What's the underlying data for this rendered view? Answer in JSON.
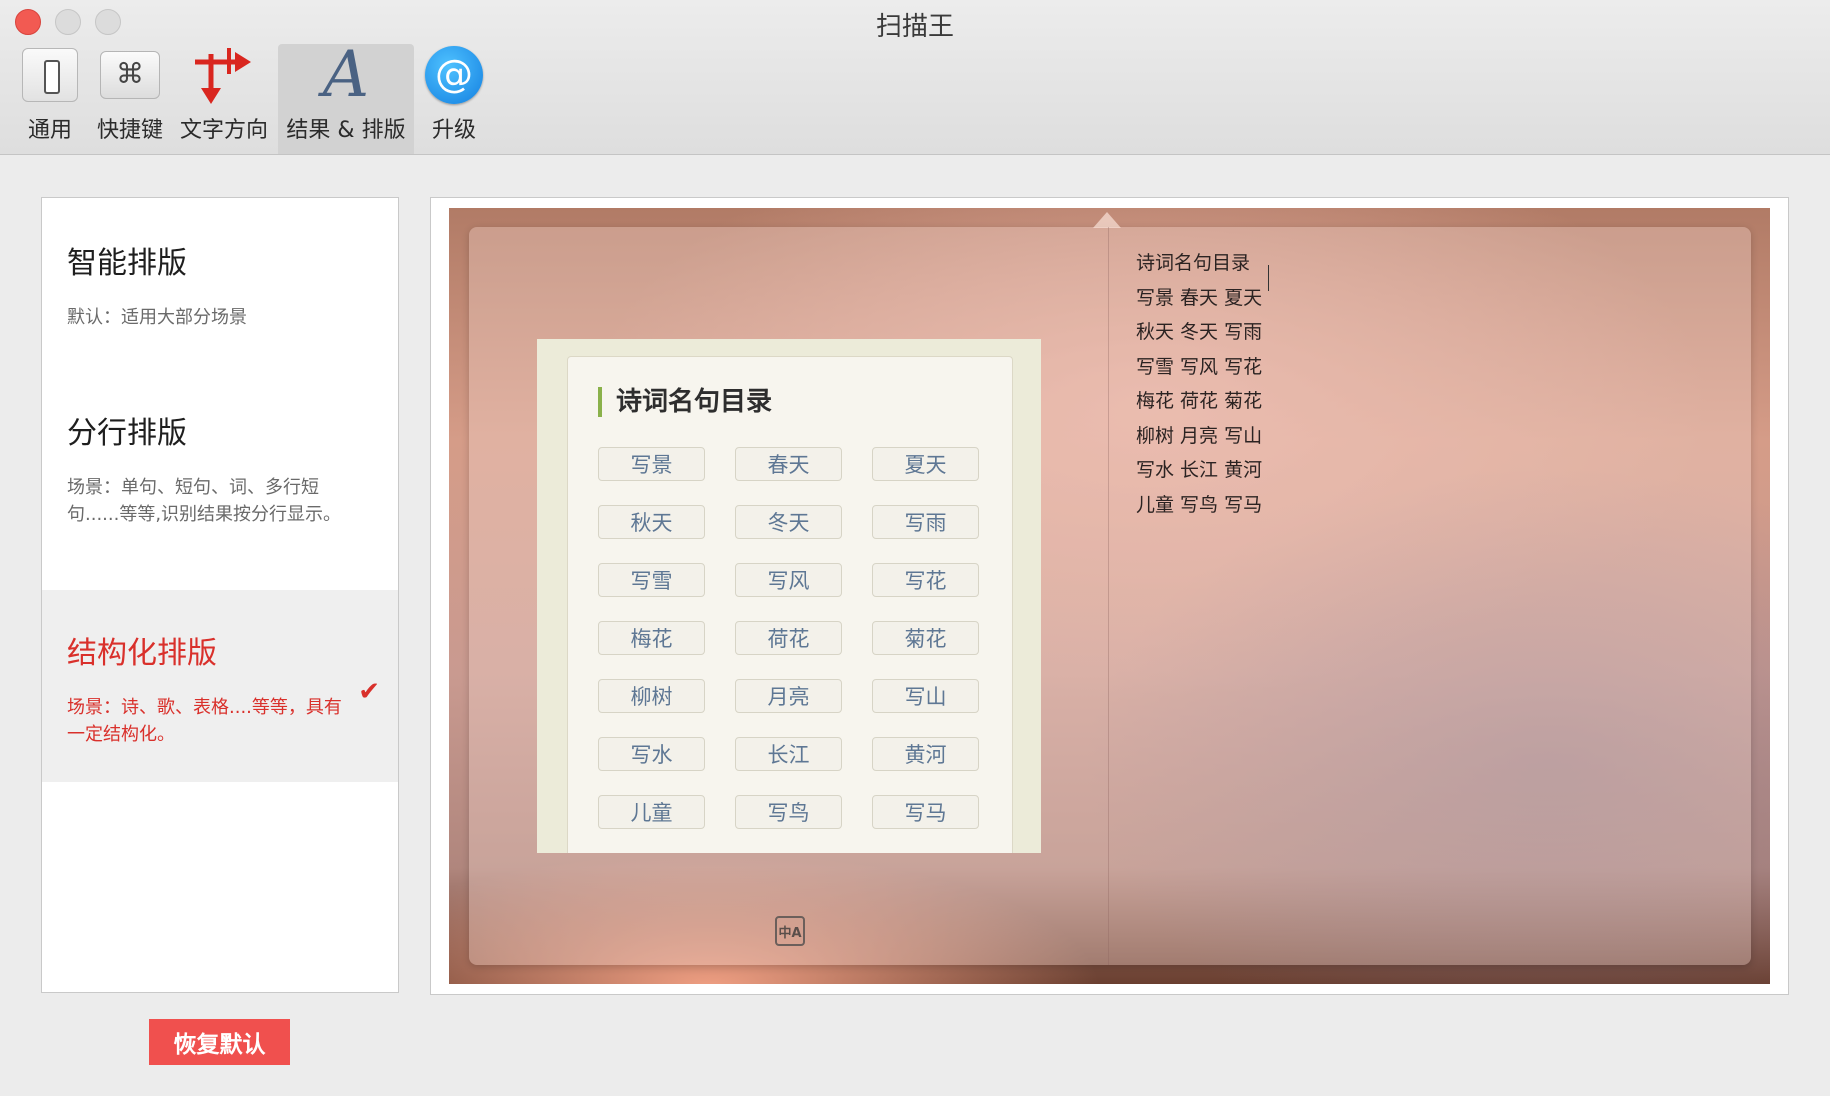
{
  "window": {
    "title": "扫描王"
  },
  "toolbar": {
    "items": [
      {
        "label": "通用",
        "icon": "phone-icon"
      },
      {
        "label": "快捷键",
        "icon": "command-key-icon",
        "glyph": "⌘"
      },
      {
        "label": "文字方向",
        "icon": "text-direction-arrows-icon"
      },
      {
        "label": "结果 & 排版",
        "icon": "letter-a-icon",
        "glyph": "A",
        "selected": true
      },
      {
        "label": "升级",
        "icon": "at-sign-icon",
        "glyph": "@"
      }
    ]
  },
  "layout_options": [
    {
      "title": "智能排版",
      "desc": "默认：适用大部分场景",
      "selected": false
    },
    {
      "title": "分行排版",
      "desc": "场景：单句、短句、词、多行短句......等等,识别结果按分行显示。",
      "selected": false
    },
    {
      "title": "结构化排版",
      "desc": "场景：诗、歌、表格....等等，具有一定结构化。",
      "selected": true,
      "check": "✔"
    }
  ],
  "reset_button": "恢复默认",
  "preview": {
    "source": {
      "title": "诗词名句目录",
      "chips": [
        "写景",
        "春天",
        "夏天",
        "秋天",
        "冬天",
        "写雨",
        "写雪",
        "写风",
        "写花",
        "梅花",
        "荷花",
        "菊花",
        "柳树",
        "月亮",
        "写山",
        "写水",
        "长江",
        "黄河",
        "儿童",
        "写鸟",
        "写马"
      ]
    },
    "translate_icon_text": "中A",
    "result_lines": [
      "诗词名句目录",
      "写景 春天 夏天",
      "秋天 冬天 写雨",
      "写雪 写风 写花",
      "梅花 荷花 菊花",
      "柳树 月亮 写山",
      "写水 长江 黄河",
      "儿童 写鸟 写马"
    ]
  },
  "colors": {
    "accent_red": "#d9302b",
    "reset_button": "#f0504e",
    "chip_text": "#5e7794",
    "title_bar_accent": "#8ab14a"
  }
}
